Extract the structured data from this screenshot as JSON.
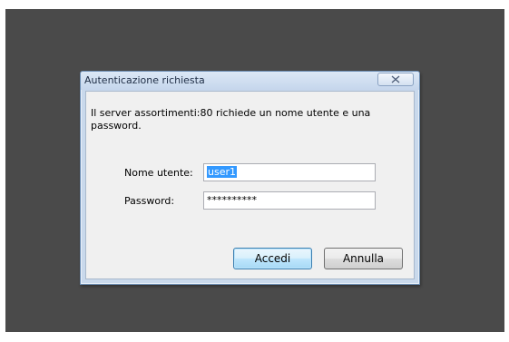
{
  "dialog": {
    "title": "Autenticazione richiesta",
    "message": "Il server assortimenti:80 richiede un nome utente e una password.",
    "username_label": "Nome utente:",
    "username_value": "user1",
    "password_label": "Password:",
    "password_value": "**********",
    "ok_label": "Accedi",
    "cancel_label": "Annulla",
    "close_icon": "close-icon"
  },
  "colors": {
    "backdrop": "#4a4a4a",
    "frame": "#c9d9ec",
    "selection": "#3399ff"
  }
}
